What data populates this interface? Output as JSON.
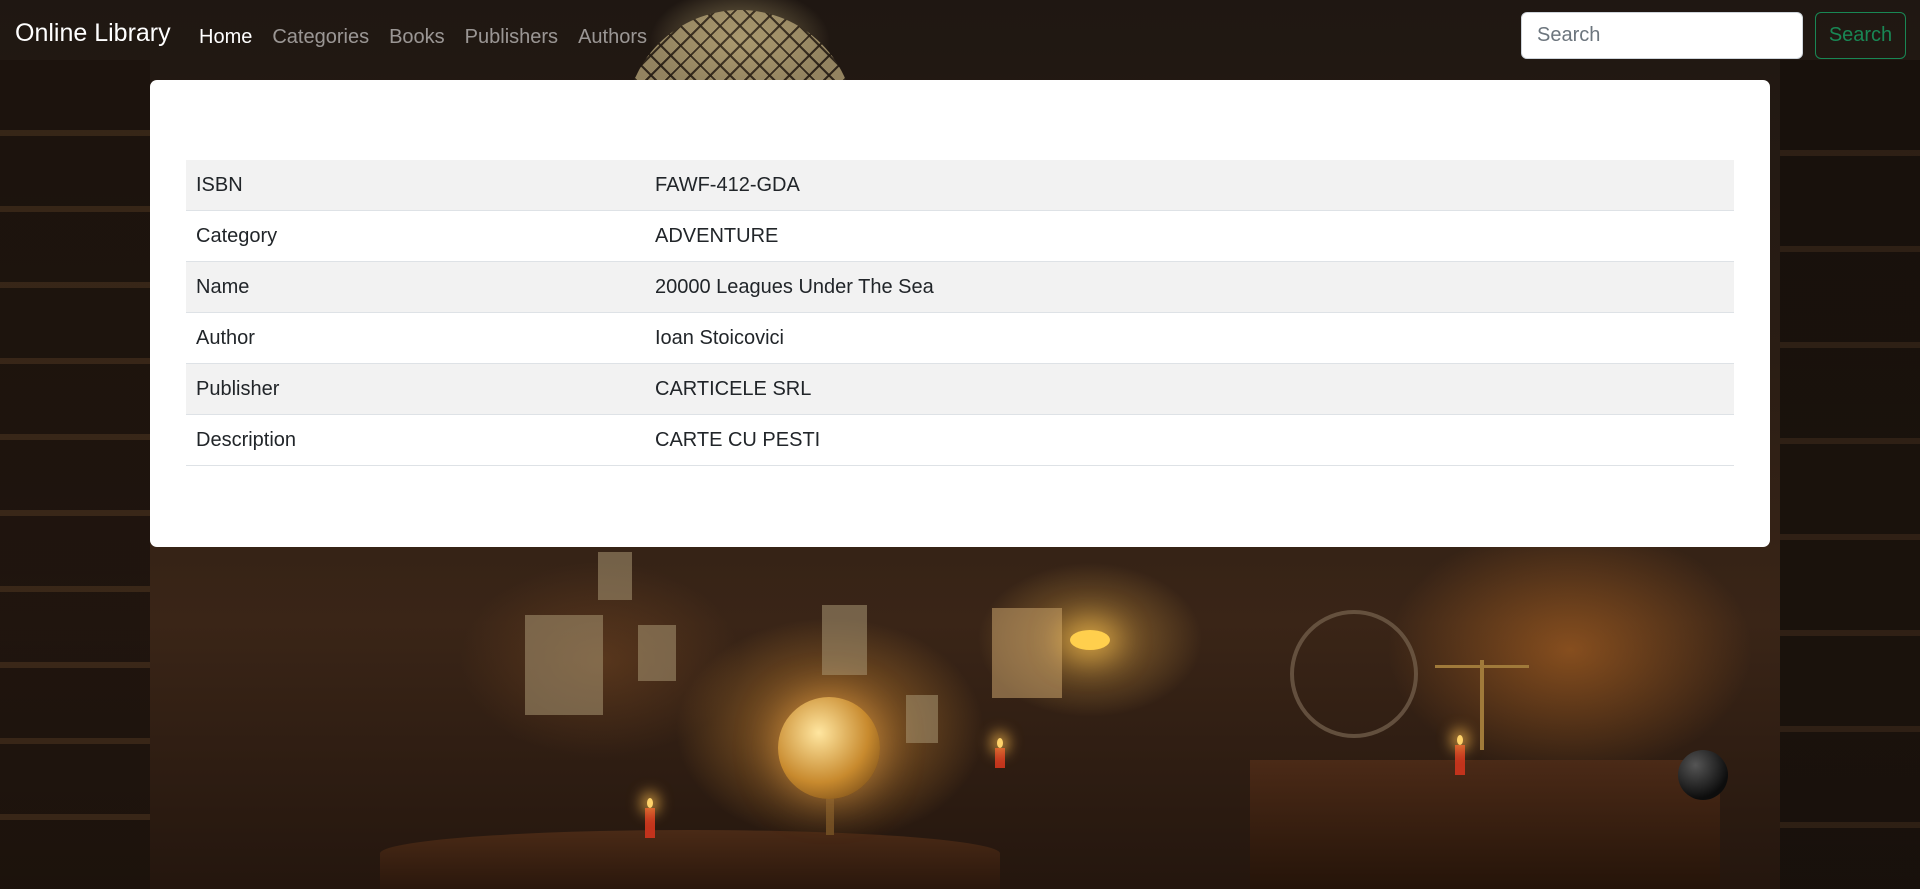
{
  "navbar": {
    "brand": "Online Library",
    "links": [
      {
        "label": "Home",
        "active": true
      },
      {
        "label": "Categories",
        "active": false
      },
      {
        "label": "Books",
        "active": false
      },
      {
        "label": "Publishers",
        "active": false
      },
      {
        "label": "Authors",
        "active": false
      }
    ],
    "search": {
      "placeholder": "Search",
      "value": "",
      "button_label": "Search"
    }
  },
  "book": {
    "rows": [
      {
        "label": "ISBN",
        "value": "FAWF-412-GDA"
      },
      {
        "label": "Category",
        "value": "ADVENTURE"
      },
      {
        "label": "Name",
        "value": "20000 Leagues Under The Sea"
      },
      {
        "label": "Author",
        "value": "Ioan Stoicovici"
      },
      {
        "label": "Publisher",
        "value": "CARTICELE SRL"
      },
      {
        "label": "Description",
        "value": "CARTE CU PESTI"
      }
    ]
  },
  "colors": {
    "search_button": "#198754",
    "striped_row": "#f2f2f2",
    "card_background": "#ffffff"
  }
}
